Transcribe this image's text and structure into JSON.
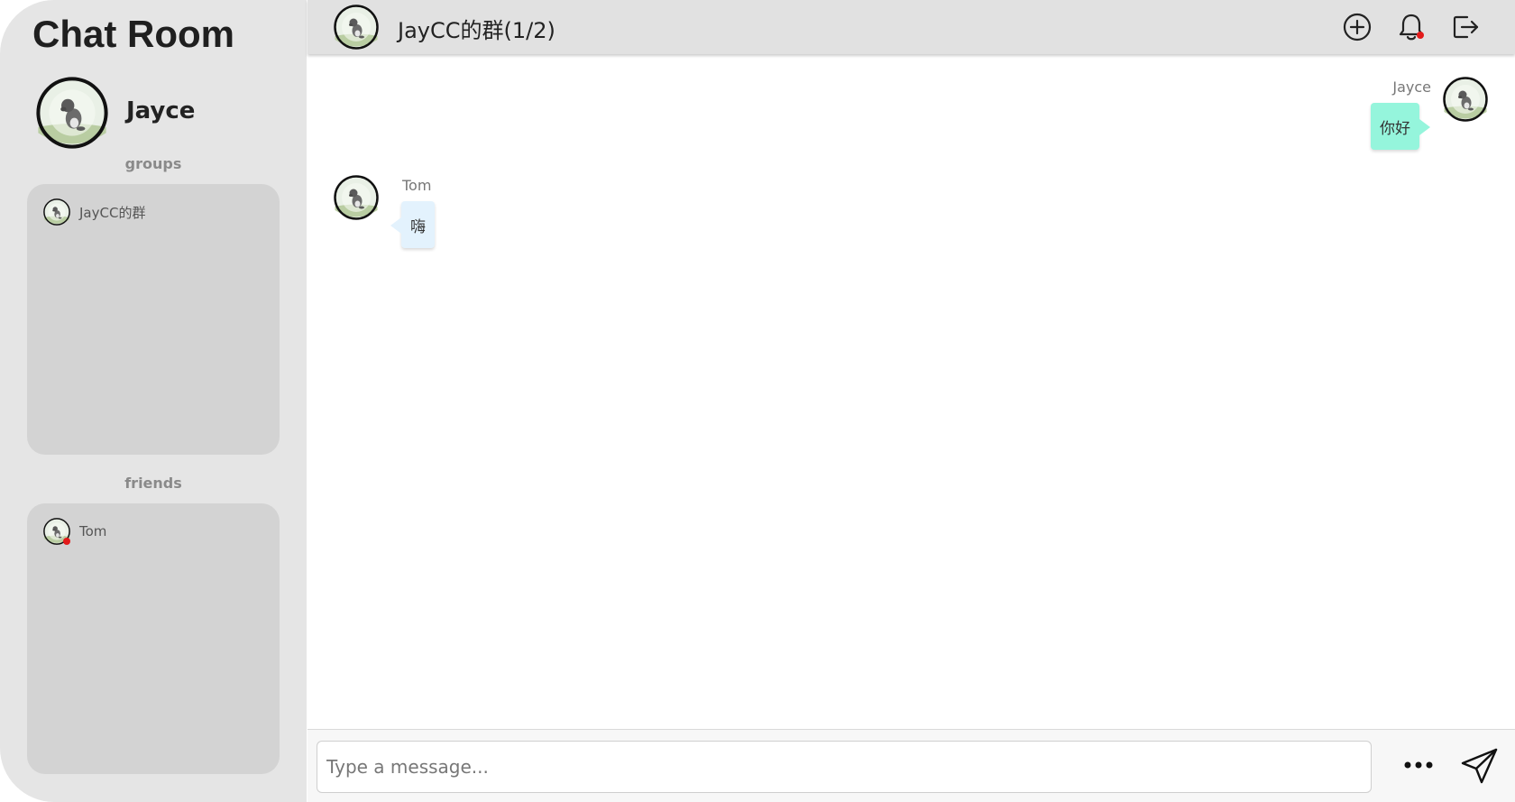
{
  "app": {
    "title": "Chat Room"
  },
  "profile": {
    "name": "Jayce"
  },
  "sidebar": {
    "groups_label": "groups",
    "friends_label": "friends",
    "groups": [
      {
        "name": "JayCC的群"
      }
    ],
    "friends": [
      {
        "name": "Tom",
        "status": "offline"
      }
    ]
  },
  "header": {
    "title": "JayCC的群(1/2)",
    "actions": [
      "add-circle-icon",
      "bell-icon",
      "logout-icon"
    ]
  },
  "messages": [
    {
      "sender": "Jayce",
      "text": "你好",
      "self": true
    },
    {
      "sender": "Tom",
      "text": "嗨",
      "self": false
    }
  ],
  "composer": {
    "placeholder": "Type a message..."
  },
  "colors": {
    "sidebar_bg": "#e5e5e5",
    "panel_bg": "#d3d3d3",
    "header_bg": "#e1e1e1",
    "self_bubble": "#95f5dc",
    "other_bubble": "#e3f2fd",
    "status_dot": "#e31b1b"
  }
}
